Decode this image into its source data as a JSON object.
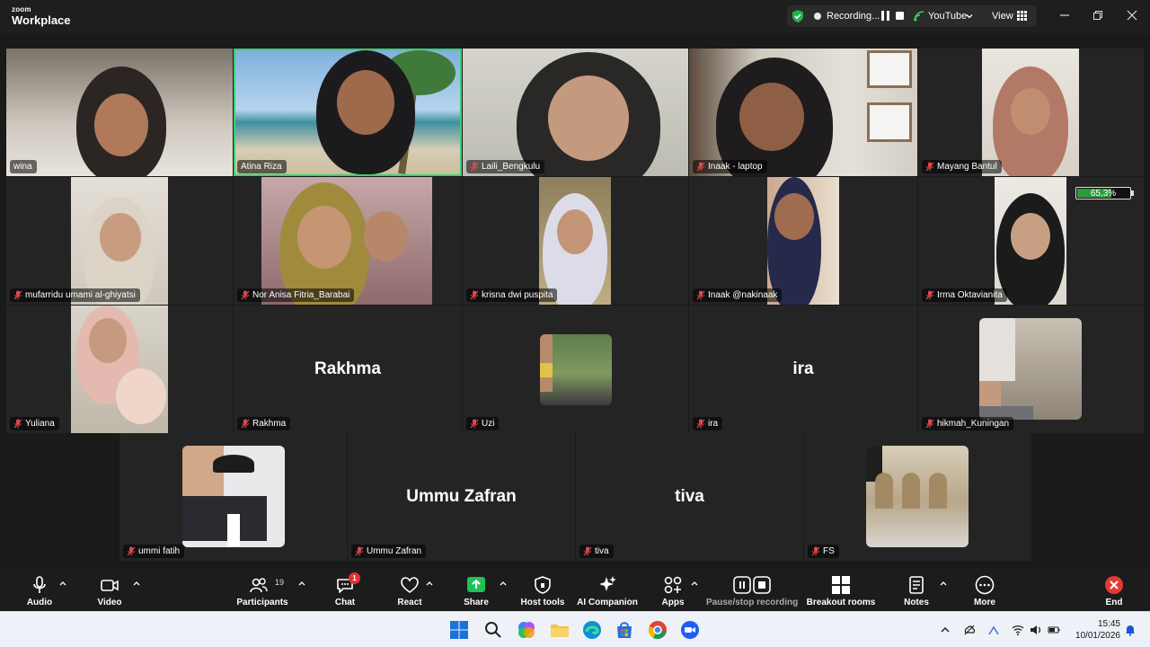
{
  "app": {
    "brand_small": "zoom",
    "brand_big": "Workplace"
  },
  "topbar": {
    "recording_label": "Recording...",
    "youtube_label": "YouTube",
    "view_label": "View",
    "accent_green": "#3ccf6e",
    "record_pill_color": "#2b2b2b"
  },
  "participants": [
    {
      "name": "wina",
      "muted": false,
      "active": false,
      "mode": "video"
    },
    {
      "name": "Atina Riza",
      "muted": false,
      "active": true,
      "mode": "video"
    },
    {
      "name": "Laili_Bengkulu",
      "muted": true,
      "active": false,
      "mode": "video"
    },
    {
      "name": "Inaak - laptop",
      "muted": true,
      "active": false,
      "mode": "video"
    },
    {
      "name": "Mayang Bantul",
      "muted": true,
      "active": false,
      "mode": "video"
    },
    {
      "name": "mufarridu umami al-ghiyatsi",
      "muted": true,
      "active": false,
      "mode": "video"
    },
    {
      "name": "Nor Anisa Fitria_Barabai",
      "muted": true,
      "active": false,
      "mode": "video"
    },
    {
      "name": "krisna dwi puspita",
      "muted": true,
      "active": false,
      "mode": "video"
    },
    {
      "name": "Inaak @nakinaak",
      "muted": true,
      "active": false,
      "mode": "video"
    },
    {
      "name": "Irma Oktavianita",
      "muted": true,
      "active": false,
      "mode": "video"
    },
    {
      "name": "Yuliana",
      "muted": true,
      "active": false,
      "mode": "video"
    },
    {
      "name": "Rakhma",
      "display": "Rakhma",
      "muted": true,
      "active": false,
      "mode": "name"
    },
    {
      "name": "Uzi",
      "muted": true,
      "active": false,
      "mode": "avatar"
    },
    {
      "name": "ira",
      "display": "ira",
      "muted": true,
      "active": false,
      "mode": "name"
    },
    {
      "name": "hikmah_Kuningan",
      "muted": true,
      "active": false,
      "mode": "avatar"
    },
    {
      "name": "ummi fatih",
      "muted": true,
      "active": false,
      "mode": "avatar"
    },
    {
      "name": "Ummu Zafran",
      "display": "Ummu Zafran",
      "muted": true,
      "active": false,
      "mode": "name"
    },
    {
      "name": "tiva",
      "display": "tiva",
      "muted": true,
      "active": false,
      "mode": "name"
    },
    {
      "name": "FS",
      "muted": true,
      "active": false,
      "mode": "avatar"
    }
  ],
  "battery": {
    "label": "65,3%",
    "level": 0.653
  },
  "toolbar": {
    "audio": "Audio",
    "video": "Video",
    "participants": "Participants",
    "participants_count": "19",
    "chat": "Chat",
    "chat_badge": "1",
    "react": "React",
    "share": "Share",
    "host_tools": "Host tools",
    "ai_companion": "AI Companion",
    "apps": "Apps",
    "pause_stop": "Pause/stop recording",
    "breakout": "Breakout rooms",
    "notes": "Notes",
    "more": "More",
    "end": "End",
    "share_color": "#1fc157",
    "end_color": "#e53935"
  },
  "taskbar": {
    "time": "15:45",
    "date": "10/01/2026"
  }
}
